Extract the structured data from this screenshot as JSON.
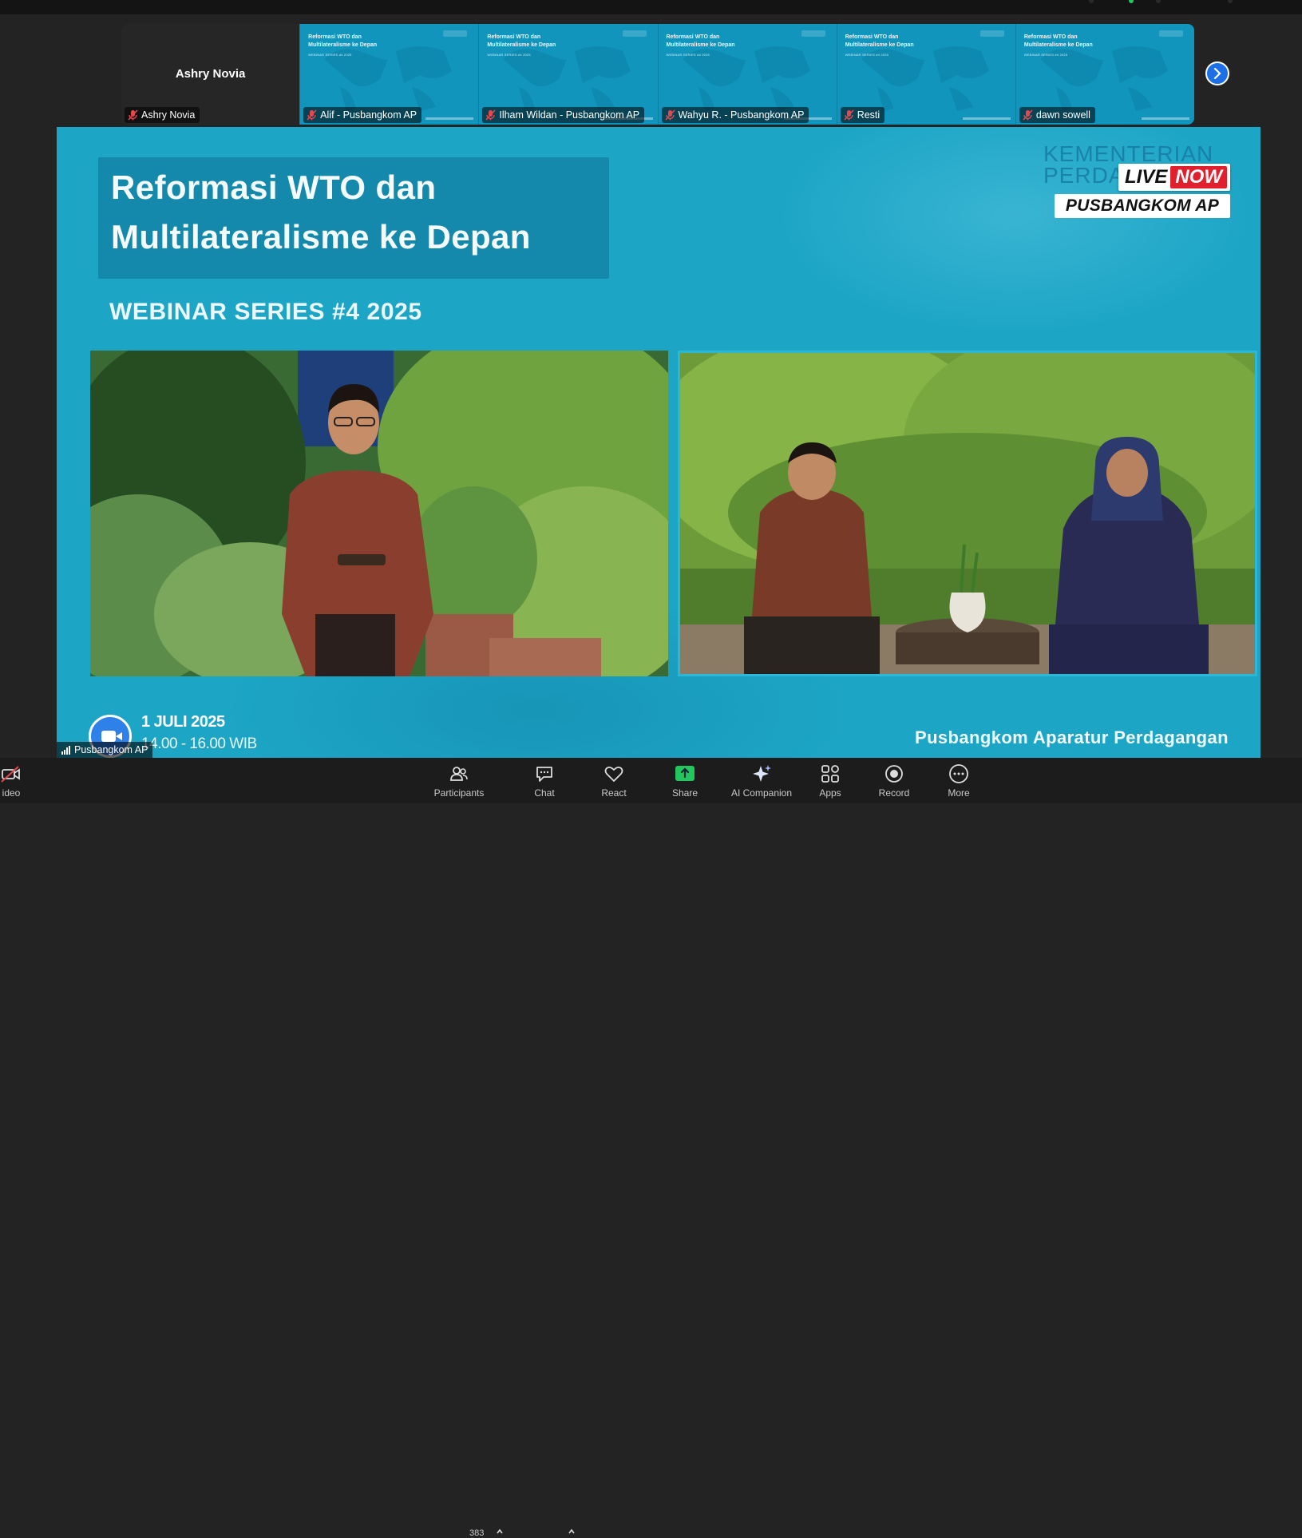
{
  "thumbnails": {
    "self_name_center": "Ashry Novia",
    "tiles": [
      {
        "name": "Ashry Novia",
        "muted": true,
        "type": "self"
      },
      {
        "name": "Alif - Pusbangkom AP",
        "muted": true,
        "type": "share"
      },
      {
        "name": "Ilham Wildan - Pusbangkom AP",
        "muted": true,
        "type": "share"
      },
      {
        "name": "Wahyu R. - Pusbangkom AP",
        "muted": true,
        "type": "share"
      },
      {
        "name": "Resti",
        "muted": true,
        "type": "share"
      },
      {
        "name": "dawn sowell",
        "muted": true,
        "type": "share"
      }
    ],
    "mini_title": "Reformasi WTO dan Multilateralisme ke Depan",
    "mini_sub": "WEBINAR SERIES #4 2025"
  },
  "shared_screen": {
    "title_line1": "Reformasi WTO dan",
    "title_line2": "Multilateralisme ke Depan",
    "series": "WEBINAR SERIES #4 2025",
    "ministry_line1": "KEMENTERIAN",
    "ministry_line2": "PERDA",
    "live_label": "LIVE",
    "now_label": "NOW",
    "org_badge": "PUSBANGKOM AP",
    "date": "1 JULI 2025",
    "time": "14.00 - 16.00 WIB",
    "footer_org": "Pusbangkom Aparatur Perdagangan"
  },
  "active_speaker": {
    "name": "Pusbangkom AP"
  },
  "toolbar": {
    "video_label": "ideo",
    "participants_label": "Participants",
    "participants_count": "383",
    "chat_label": "Chat",
    "react_label": "React",
    "share_label": "Share",
    "ai_label": "AI Companion",
    "apps_label": "Apps",
    "record_label": "Record",
    "more_label": "More"
  },
  "colors": {
    "stage_bg": "#1da5c6",
    "share_green": "#22c55e",
    "zoom_blue": "#2f81ea",
    "live_red": "#e1202d"
  }
}
